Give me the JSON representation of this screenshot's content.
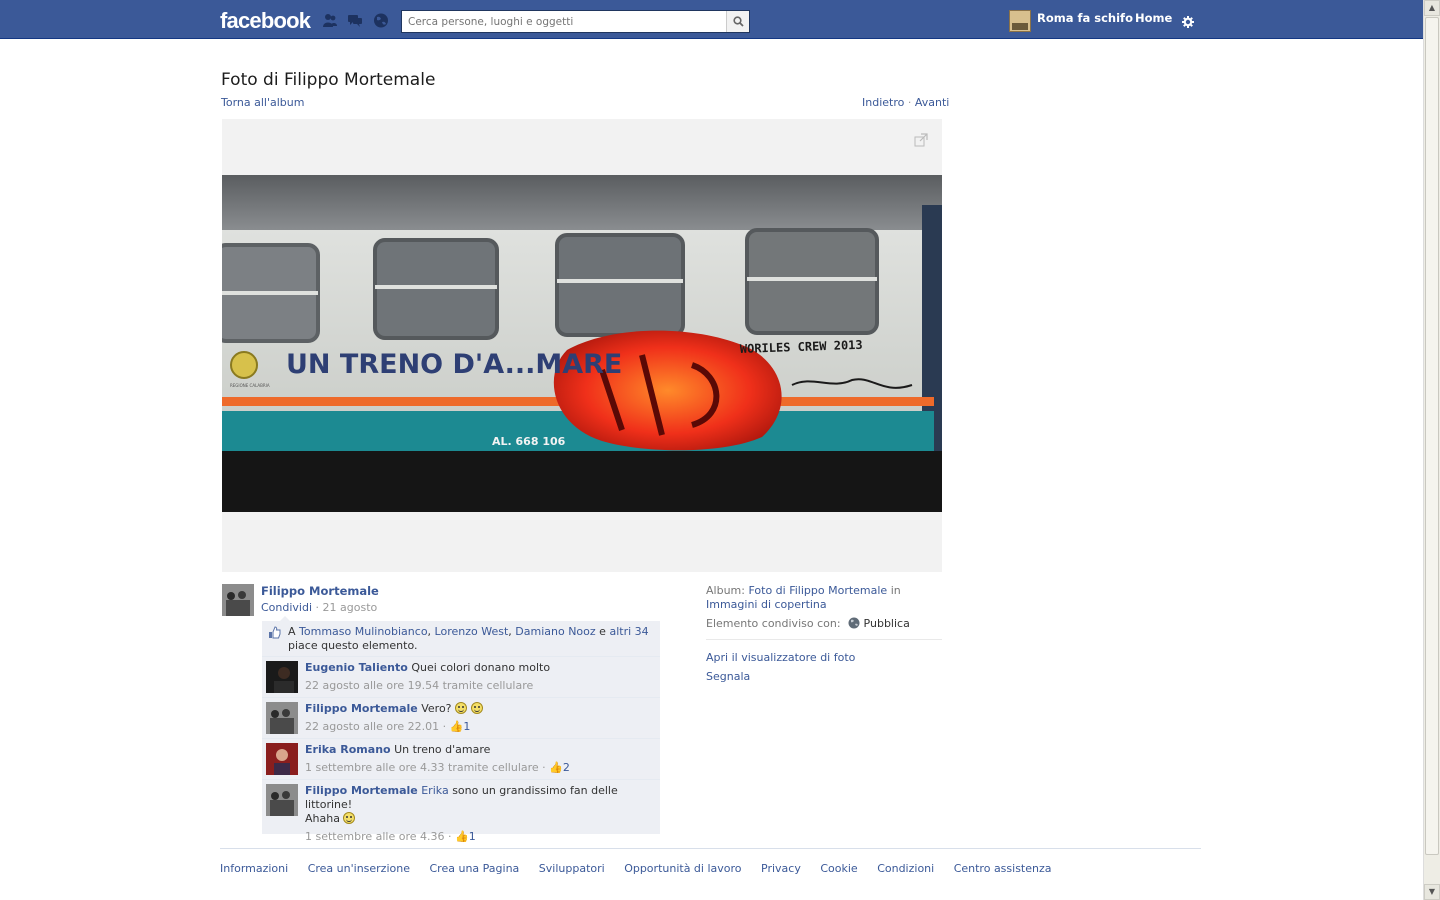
{
  "topbar": {
    "logo": "facebook",
    "search_placeholder": "Cerca persone, luoghi e oggetti",
    "page_name": "Roma fa schifo",
    "home_label": "Home"
  },
  "header": {
    "title": "Foto di Filippo Mortemale",
    "back_link": "Torna all'album",
    "prev": "Indietro",
    "separator": "·",
    "next": "Avanti"
  },
  "photo": {
    "texts": {
      "main": "UN TRENO D'A...MARE",
      "tag": "WORILES CREW 2013",
      "code": "AL. 668 106",
      "region": "REGIONE CALABRIA"
    }
  },
  "post": {
    "owner": "Filippo Mortemale",
    "share": "Condividi",
    "sep": "·",
    "date": "21 agosto"
  },
  "likes": {
    "prefix": "A",
    "names": [
      "Tommaso Mulinobianco",
      "Lorenzo West",
      "Damiano Nooz"
    ],
    "conj": "e",
    "others": "altri 34",
    "suffix": "piace questo elemento."
  },
  "comments": [
    {
      "name": "Eugenio Taliento",
      "text": "Quei colori donano molto",
      "meta": "22 agosto alle ore 19.54 tramite cellulare",
      "likes": ""
    },
    {
      "name": "Filippo Mortemale",
      "text": "Vero?",
      "meta": "22 agosto alle ore 22.01",
      "likes": "1"
    },
    {
      "name": "Erika Romano",
      "text": "Un treno d'amare",
      "meta": "1 settembre alle ore 4.33 tramite cellulare",
      "likes": "2"
    },
    {
      "name": "Filippo Mortemale",
      "mention": "Erika",
      "text": "sono un grandissimo fan delle littorine!",
      "text2": "Ahaha",
      "meta": "1 settembre alle ore 4.36",
      "likes": "1"
    }
  ],
  "sidebar": {
    "album_label": "Album:",
    "album_name": "Foto di Filippo Mortemale",
    "in": "in",
    "album_parent": "Immagini di copertina",
    "shared_label": "Elemento condiviso con:",
    "privacy": "Pubblica",
    "viewer_link": "Apri il visualizzatore di foto",
    "report_link": "Segnala"
  },
  "footer": {
    "links": [
      "Informazioni",
      "Crea un'inserzione",
      "Crea una Pagina",
      "Sviluppatori",
      "Opportunità di lavoro",
      "Privacy",
      "Cookie",
      "Condizioni",
      "Centro assistenza"
    ]
  },
  "colors": {
    "brand": "#3b5998",
    "ufi_bg": "#edeff4"
  }
}
